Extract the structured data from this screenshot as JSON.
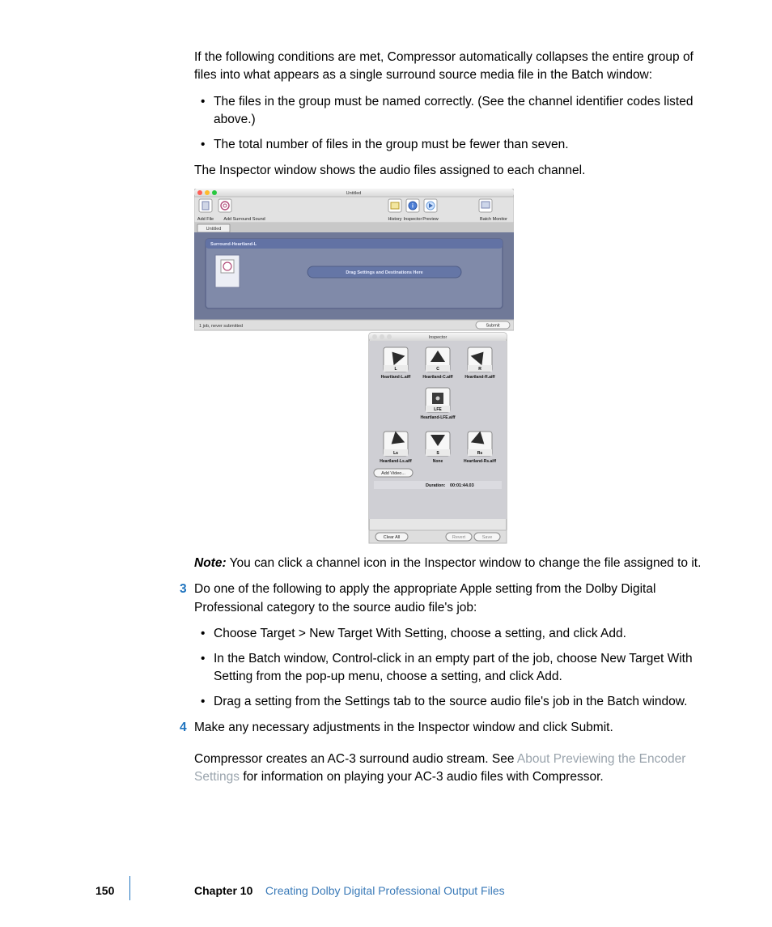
{
  "para1": "If the following conditions are met, Compressor automatically collapses the entire group of files into what appears as a single surround source media file in the Batch window:",
  "bullet1": "The files in the group must be named correctly. (See the channel identifier codes listed above.)",
  "bullet2": "The total number of files in the group must be fewer than seven.",
  "para2": "The Inspector window shows the audio files assigned to each channel.",
  "batch": {
    "title": "Untitled",
    "tb_addfile": "Add File",
    "tb_addsurround": "Add Surround Sound",
    "tb_history": "History",
    "tb_inspector": "Inspector",
    "tb_preview": "Preview",
    "tb_batchmonitor": "Batch Monitor",
    "tab": "Untitled",
    "job_name": "Surround-Heartland-L",
    "drop_text": "Drag Settings and Destinations Here",
    "status": "1 job, never submitted",
    "submit": "Submit"
  },
  "inspector": {
    "title": "Inspector",
    "ch": {
      "L": {
        "label": "L",
        "file": "Heartland-L.aiff"
      },
      "C": {
        "label": "C",
        "file": "Heartland-C.aiff"
      },
      "R": {
        "label": "R",
        "file": "Heartland-R.aiff"
      },
      "LFE": {
        "label": "LFE",
        "file": "Heartland-LFE.aiff"
      },
      "Ls": {
        "label": "Ls",
        "file": "Heartland-Ls.aiff"
      },
      "S": {
        "label": "S",
        "file": "None"
      },
      "Rs": {
        "label": "Rs",
        "file": "Heartland-Rs.aiff"
      }
    },
    "addvideo": "Add Video...",
    "duration_label": "Duration:",
    "duration_value": "00:01:44.03",
    "clearall": "Clear All",
    "revert": "Revert",
    "save": "Save"
  },
  "note_lead": "Note:",
  "note_body": "  You can click a channel icon in the Inspector window to change the file assigned to it.",
  "step3_num": "3",
  "step3": "Do one of the following to apply the appropriate Apple setting from the Dolby Digital Professional category to the source audio file's job:",
  "step3b1": "Choose Target > New Target With Setting, choose a setting, and click Add.",
  "step3b2": "In the Batch window, Control-click in an empty part of the job, choose New Target With Setting from the pop-up menu, choose a setting, and click Add.",
  "step3b3": "Drag a setting from the Settings tab to the source audio file's job in the Batch window.",
  "step4_num": "4",
  "step4": "Make any necessary adjustments in the Inspector window and click Submit.",
  "closing_a": "Compressor creates an AC-3 surround audio stream. See ",
  "closing_link": "About Previewing the Encoder Settings",
  "closing_b": " for information on playing your AC-3 audio files with Compressor.",
  "footer": {
    "page": "150",
    "chapter_label": "Chapter 10",
    "chapter_title": "Creating Dolby Digital Professional Output Files"
  }
}
